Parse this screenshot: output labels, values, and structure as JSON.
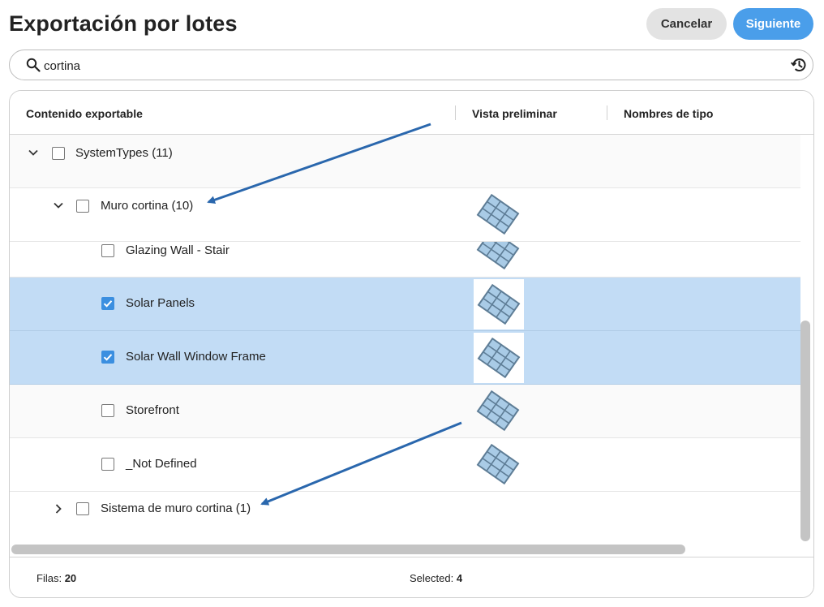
{
  "header": {
    "title": "Exportación por lotes",
    "cancel_label": "Cancelar",
    "next_label": "Siguiente"
  },
  "search": {
    "value": "cortina",
    "search_icon": "search-icon",
    "history_icon": "history-icon"
  },
  "table": {
    "columns": [
      "Contenido exportable",
      "Vista preliminar",
      "Nombres de tipo"
    ],
    "rows": [
      {
        "label": "SystemTypes (11)",
        "level": 0,
        "expanded": true,
        "checked": false,
        "selected": false,
        "has_thumb": false
      },
      {
        "label": "Muro cortina (10)",
        "level": 1,
        "expanded": true,
        "checked": false,
        "selected": false,
        "has_thumb": true
      },
      {
        "label": "Glazing Wall - Stair",
        "level": 2,
        "checked": false,
        "selected": false,
        "has_thumb": true
      },
      {
        "label": "Solar Panels",
        "level": 2,
        "checked": true,
        "selected": true,
        "has_thumb": true
      },
      {
        "label": "Solar Wall Window Frame",
        "level": 2,
        "checked": true,
        "selected": true,
        "has_thumb": true
      },
      {
        "label": "Storefront",
        "level": 2,
        "checked": false,
        "selected": false,
        "has_thumb": true
      },
      {
        "label": "_Not Defined",
        "level": 2,
        "checked": false,
        "selected": false,
        "has_thumb": true
      },
      {
        "label": "Sistema de muro cortina (1)",
        "level": 1,
        "expanded": false,
        "checked": false,
        "selected": false,
        "has_thumb": false
      }
    ]
  },
  "footer": {
    "rows_label": "Filas:",
    "rows_value": "20",
    "selected_label": "Selected:",
    "selected_value": "4"
  },
  "colors": {
    "accent": "#4a9eea",
    "selection": "#c2dcf5",
    "annotation_arrow": "#2a67ad"
  }
}
